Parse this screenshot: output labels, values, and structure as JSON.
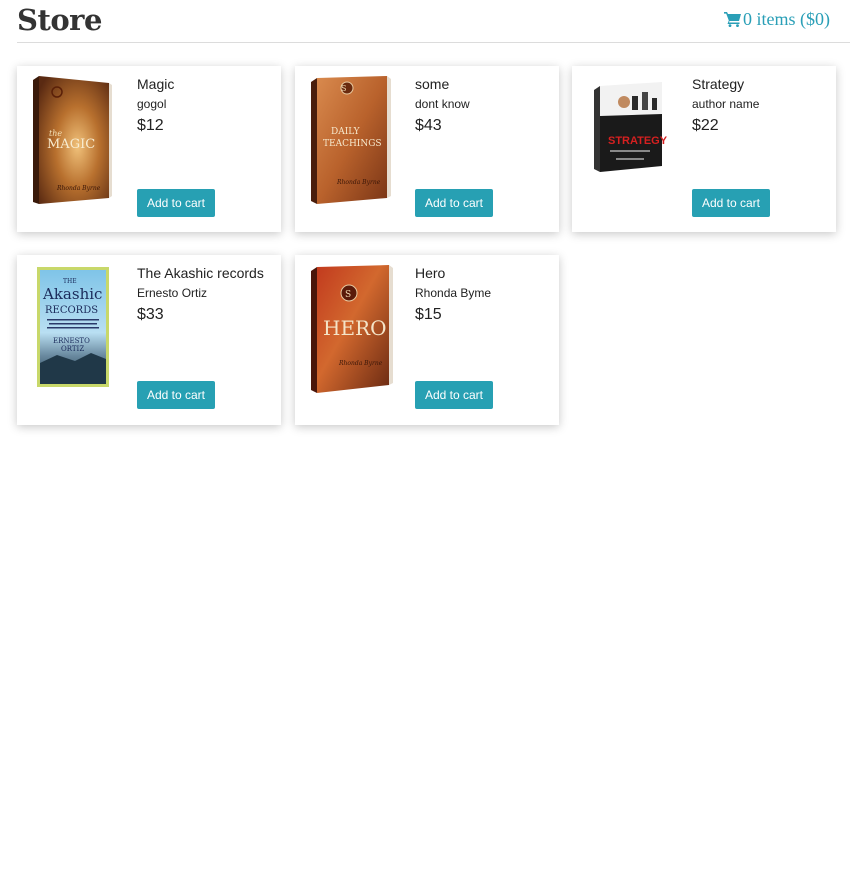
{
  "header": {
    "title": "Store",
    "cart": {
      "icon": "shopping-cart-icon",
      "label": "0 items ($0)"
    }
  },
  "colors": {
    "accent": "#27a0b3",
    "link": "#2a9fb7",
    "text": "#222222"
  },
  "products": [
    {
      "title": "Magic",
      "author": "gogol",
      "price": "$12",
      "button": "Add to cart",
      "cover": "book-cover-magic"
    },
    {
      "title": "some",
      "author": "dont know",
      "price": "$43",
      "button": "Add to cart",
      "cover": "book-cover-daily-teachings"
    },
    {
      "title": "Strategy",
      "author": "author name",
      "price": "$22",
      "button": "Add to cart",
      "cover": "book-cover-strategy"
    },
    {
      "title": "The Akashic records",
      "author": "Ernesto Ortiz",
      "price": "$33",
      "button": "Add to cart",
      "cover": "book-cover-akashic-records"
    },
    {
      "title": "Hero",
      "author": "Rhonda Byme",
      "price": "$15",
      "button": "Add to cart",
      "cover": "book-cover-hero"
    }
  ]
}
